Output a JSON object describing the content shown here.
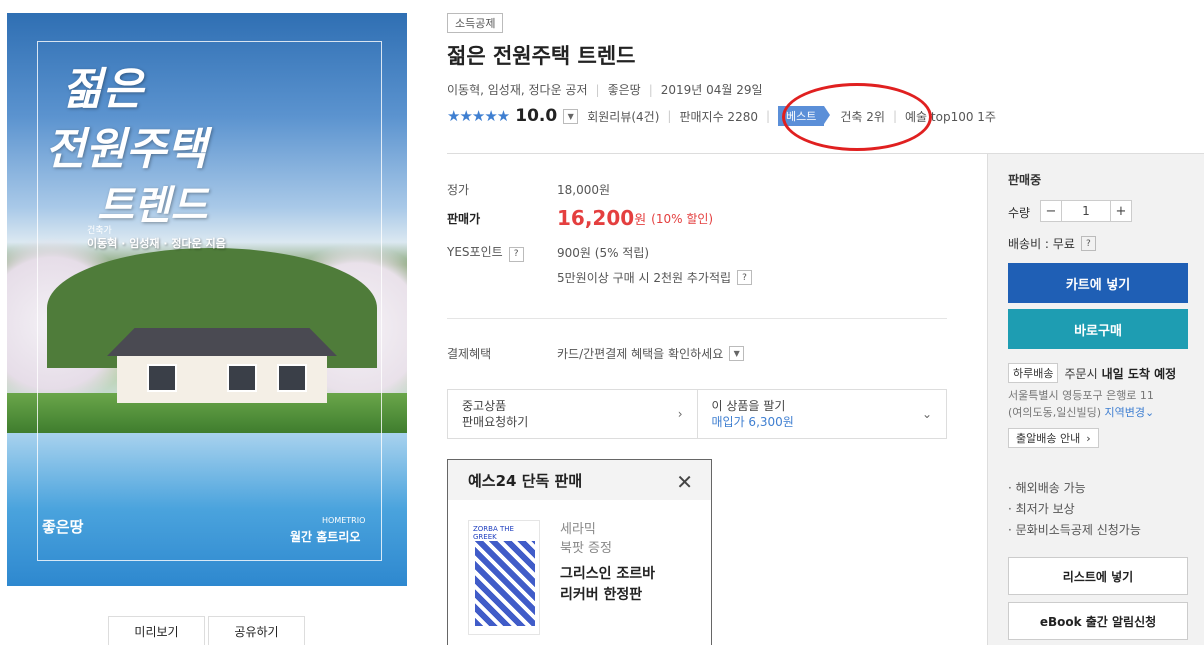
{
  "cover": {
    "title_lines": [
      "젊은",
      "전원주택",
      "트렌드"
    ],
    "subtitle": "건축가",
    "authors": "이동혁 · 임성재 · 정다운 지음",
    "publisher": "좋은땅",
    "brand": "HOMETRIO",
    "magazine": "월간 홈트리오"
  },
  "left_buttons": {
    "preview": "미리보기",
    "share": "공유하기"
  },
  "product": {
    "tag": "소득공제",
    "title": "젊은 전원주택 트렌드",
    "authors": "이동혁, 임성재, 정다운 공저",
    "publisher": "좋은땅",
    "date": "2019년 04월 29일",
    "stars": "★★★★★",
    "score": "10.0",
    "reviews": "회원리뷰(4건)",
    "sales_index": "판매지수 2280",
    "best_badge": "베스트",
    "best_rank": "건축 2위",
    "best_extra": "예술 top100 1주"
  },
  "price": {
    "list_label": "정가",
    "list_value": "18,000원",
    "sale_label": "판매가",
    "sale_value": "16,200",
    "sale_unit": "원",
    "discount": "(10% 할인)",
    "points_label": "YES포인트",
    "points_value": "900원 (5% 적립)",
    "bonus": "5만원이상 구매 시 2천원 추가적립",
    "payment_label": "결제혜택",
    "payment_value": "카드/간편결제 혜택을 확인하세요"
  },
  "used": {
    "left_title": "중고상품",
    "left_sub": "판매요청하기",
    "right_title": "이 상품을 팔기",
    "right_sub": "매입가 6,300원"
  },
  "exclusive": {
    "header": "예스24 단독 판매",
    "book_cover_text": "ZORBA THE GREEK",
    "line1": "세라믹",
    "line2": "북팟 증정",
    "title1": "그리스인 조르바",
    "title2": "리커버 한정판"
  },
  "panel": {
    "status": "판매중",
    "qty_label": "수량",
    "qty_value": "1",
    "shipping_label": "배송비 : 무료",
    "cart_btn": "카트에 넣기",
    "buy_btn": "바로구매",
    "delivery_tag": "하루배송",
    "delivery_text_pre": "주문시",
    "delivery_text_bold": "내일 도착 예정",
    "address1": "서울특별시 영등포구 은행로 11",
    "address2": "(여의도동,일신빌딩)",
    "region_change": "지역변경",
    "bulk_btn": "출알배송 안내",
    "features": [
      "· 해외배송 가능",
      "· 최저가 보상",
      "· 문화비소득공제 신청가능"
    ],
    "list_btn": "리스트에 넣기",
    "ebook_btn": "eBook 출간 알림신청"
  },
  "colors": {
    "accent_blue": "#1f5fb5",
    "teal": "#1e9db2",
    "price_red": "#e43f3f",
    "annotation": "#e02020"
  }
}
